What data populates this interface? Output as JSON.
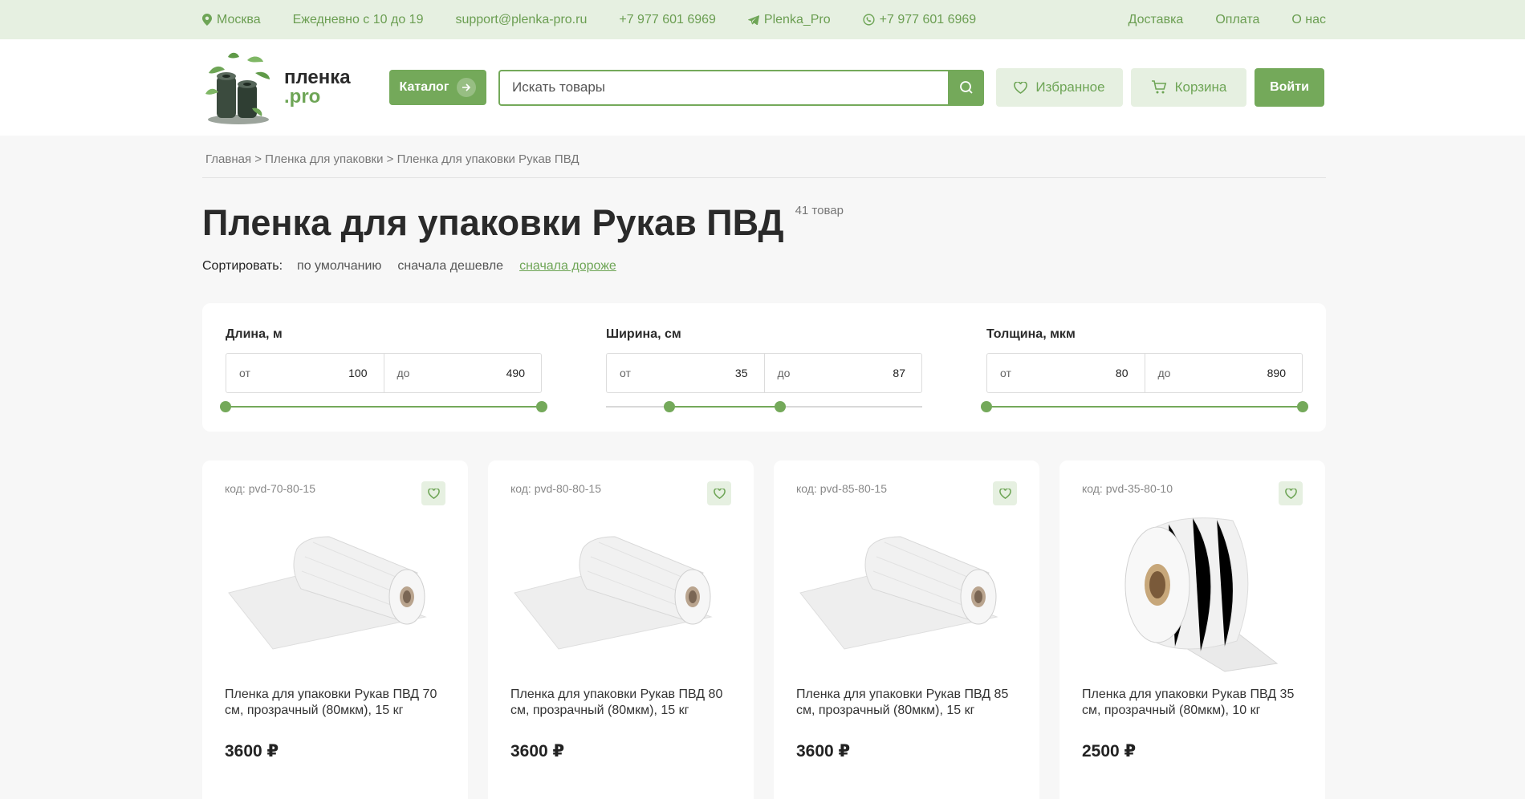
{
  "topbar": {
    "city": "Москва",
    "hours": "Ежедневно с 10 до 19",
    "email": "support@plenka-pro.ru",
    "phone": "+7 977 601 6969",
    "telegram": "Plenka_Pro",
    "whatsapp": "+7 977 601 6969",
    "links": [
      "Доставка",
      "Оплата",
      "О нас"
    ]
  },
  "header": {
    "logo_line1": "пленка",
    "logo_line2": ".pro",
    "catalog_label": "Каталог",
    "search_placeholder": "Искать товары",
    "favorites_label": "Избранное",
    "cart_label": "Корзина",
    "login_label": "Войти"
  },
  "breadcrumbs": "Главная > Пленка для упаковки > Пленка для упаковки Рукав ПВД",
  "page": {
    "title": "Пленка для упаковки Рукав ПВД",
    "count": "41 товар"
  },
  "sort": {
    "label": "Сортировать:",
    "options": [
      "по умолчанию",
      "сначала дешевле",
      "сначала дороже"
    ],
    "active_index": 2
  },
  "filters": [
    {
      "label": "Длина, м",
      "from_prefix": "от",
      "from": "100",
      "to_prefix": "до",
      "to": "490",
      "range_start": 0.0,
      "range_end": 1.0
    },
    {
      "label": "Ширина, см",
      "from_prefix": "от",
      "from": "35",
      "to_prefix": "до",
      "to": "87",
      "range_start": 0.2,
      "range_end": 0.55
    },
    {
      "label": "Толщина, мкм",
      "from_prefix": "от",
      "from": "80",
      "to_prefix": "до",
      "to": "890",
      "range_start": 0.0,
      "range_end": 1.0
    }
  ],
  "products": [
    {
      "code": "код: pvd-70-80-15",
      "name": "Пленка для упаковки Рукав ПВД 70 см, прозрачный (80мкм), 15 кг",
      "price": "3600 ₽",
      "image": "film-roll-flat"
    },
    {
      "code": "код: pvd-80-80-15",
      "name": "Пленка для упаковки Рукав ПВД 80 см, прозрачный (80мкм), 15 кг",
      "price": "3600 ₽",
      "image": "film-roll-flat"
    },
    {
      "code": "код: pvd-85-80-15",
      "name": "Пленка для упаковки Рукав ПВД 85 см, прозрачный (80мкм), 15 кг",
      "price": "3600 ₽",
      "image": "film-roll-flat"
    },
    {
      "code": "код: pvd-35-80-10",
      "name": "Пленка для упаковки Рукав ПВД 35 см, прозрачный (80мкм), 10 кг",
      "price": "2500 ₽",
      "image": "film-roll-standing"
    }
  ],
  "colors": {
    "accent": "#74a95a",
    "accent_light": "#e6f0e1",
    "text_green": "#6ea556"
  }
}
